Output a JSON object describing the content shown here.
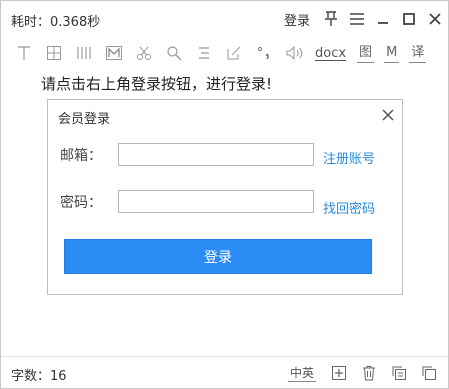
{
  "titlebar": {
    "elapsed": "耗时：0.368秒",
    "login": "登录"
  },
  "toolbar": {
    "docx": "docx",
    "image": "图",
    "markdown": "M",
    "translate": "译"
  },
  "prompt": "请点击右上角登录按钮，进行登录!",
  "dialog": {
    "title": "会员登录",
    "email_label": "邮箱：",
    "email_value": "",
    "register_link": "注册账号",
    "password_label": "密码：",
    "password_value": "",
    "recover_link": "找回密码",
    "submit_label": "登录"
  },
  "statusbar": {
    "char_count": "字数：16",
    "lang_toggle": "中英"
  },
  "colors": {
    "accent": "#2b8cf5",
    "link": "#2a8bd8"
  }
}
